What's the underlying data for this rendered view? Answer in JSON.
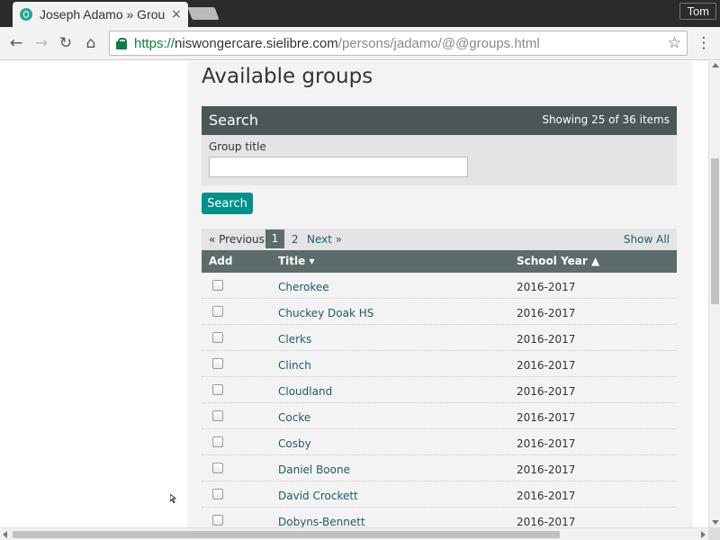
{
  "browser": {
    "tab_title": "Joseph Adamo » Groups",
    "tab_close": "×",
    "profile_name": "Tom",
    "url_scheme": "https://",
    "url_host": "niswongercare.sielibre.com",
    "url_path": "/persons/jadamo/@@groups.html",
    "back_glyph": "←",
    "forward_glyph": "→",
    "reload_glyph": "↻",
    "home_glyph": "⌂",
    "star_glyph": "☆",
    "menu_glyph": "⋮"
  },
  "page": {
    "heading": "Available groups",
    "search": {
      "title": "Search",
      "showing": "Showing 25 of 36 items",
      "field_label": "Group title",
      "field_value": "",
      "button_label": "Search"
    },
    "pager": {
      "previous": "« Previous",
      "current_page": "1",
      "page_2": "2",
      "next": "Next »",
      "show_all": "Show All"
    },
    "table": {
      "col_add": "Add",
      "col_title": "Title ▾",
      "col_year": "School Year ▲",
      "rows": [
        {
          "title": "Cherokee",
          "year": "2016-2017"
        },
        {
          "title": "Chuckey Doak HS",
          "year": "2016-2017"
        },
        {
          "title": "Clerks",
          "year": "2016-2017"
        },
        {
          "title": "Clinch",
          "year": "2016-2017"
        },
        {
          "title": "Cloudland",
          "year": "2016-2017"
        },
        {
          "title": "Cocke",
          "year": "2016-2017"
        },
        {
          "title": "Cosby",
          "year": "2016-2017"
        },
        {
          "title": "Daniel Boone",
          "year": "2016-2017"
        },
        {
          "title": "David Crockett",
          "year": "2016-2017"
        },
        {
          "title": "Dobyns-Bennett",
          "year": "2016-2017"
        }
      ]
    }
  },
  "colors": {
    "search_header": "#4d5656",
    "table_header": "#5d6b6b",
    "accent_button": "#00918b",
    "link": "#225b67"
  }
}
